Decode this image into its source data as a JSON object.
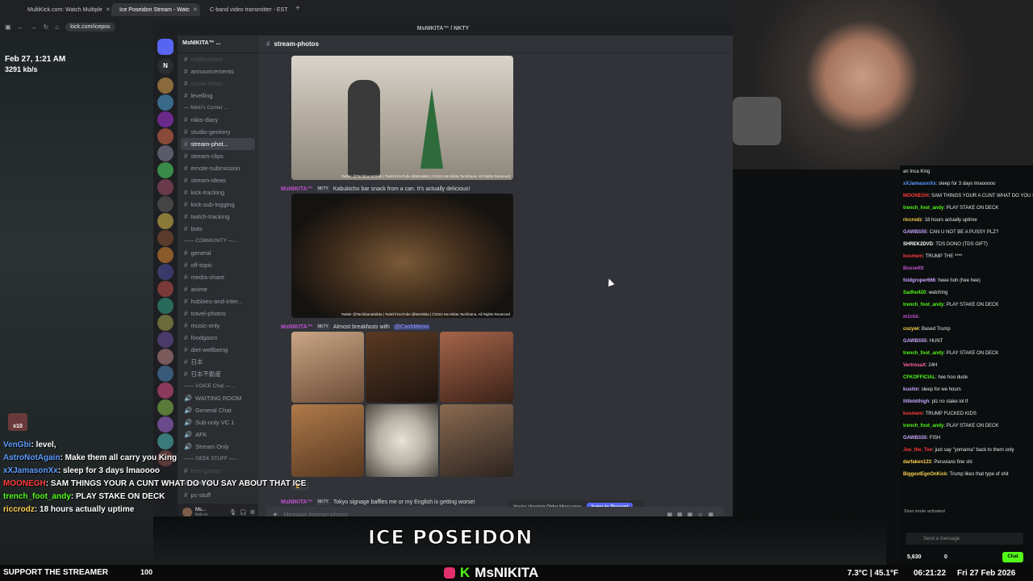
{
  "browser": {
    "tabs": [
      {
        "label": "MultiKick.com: Watch Multiple",
        "color": "#5865f2"
      },
      {
        "label": "Ice Poseidon Stream - Watc",
        "color": "#53fc18"
      },
      {
        "label": "C-band video transmitter - EST",
        "color": "#1a73e8"
      }
    ],
    "url": "kick.com/icepos"
  },
  "stream_left": {
    "timestamp": "Feb 27, 1:21 AM",
    "bitrate": "3291 kb/s"
  },
  "discord": {
    "window_title": "MsNIKITA™ / NKTY",
    "server_name": "MsNIKITA™ ...",
    "channel_header": "stream-photos",
    "channels": [
      {
        "label": "notifications",
        "type": "muted"
      },
      {
        "label": "announcements",
        "type": "normal"
      },
      {
        "label": "social-feeds",
        "type": "muted"
      },
      {
        "label": "levelling",
        "type": "normal"
      },
      {
        "label": "— Nikki's Corner ...",
        "type": "cat"
      },
      {
        "label": "nikis-diary",
        "type": "normal"
      },
      {
        "label": "studio-geekery",
        "type": "normal"
      },
      {
        "label": "stream-phot...",
        "type": "sel"
      },
      {
        "label": "stream-clips",
        "type": "normal"
      },
      {
        "label": "emote-submission",
        "type": "normal"
      },
      {
        "label": "stream-ideas",
        "type": "normal"
      },
      {
        "label": "kick-tracking",
        "type": "normal"
      },
      {
        "label": "kick-sub-logging",
        "type": "normal"
      },
      {
        "label": "twitch-tracking",
        "type": "normal"
      },
      {
        "label": "bots",
        "type": "normal"
      },
      {
        "label": "—— COMMUNITY —...",
        "type": "cat"
      },
      {
        "label": "general",
        "type": "normal"
      },
      {
        "label": "off-topic",
        "type": "normal"
      },
      {
        "label": "media-share",
        "type": "normal"
      },
      {
        "label": "anime",
        "type": "normal"
      },
      {
        "label": "hobbies-and-inter...",
        "type": "normal"
      },
      {
        "label": "travel-photos",
        "type": "normal"
      },
      {
        "label": "music-only",
        "type": "normal"
      },
      {
        "label": "foodgasm",
        "type": "normal"
      },
      {
        "label": "diet-wellbeing",
        "type": "normal"
      },
      {
        "label": "日本",
        "type": "normal"
      },
      {
        "label": "日本不動産",
        "type": "normal"
      },
      {
        "label": "—— VOICE Chat —...",
        "type": "cat"
      },
      {
        "label": "WAITING ROOM",
        "type": "voice"
      },
      {
        "label": "General Chat",
        "type": "voice"
      },
      {
        "label": "Sub-only VC 1",
        "type": "voice"
      },
      {
        "label": "AFK",
        "type": "voice"
      },
      {
        "label": "Stream Only",
        "type": "voice"
      },
      {
        "label": "—— GEEK STUFF —...",
        "type": "cat"
      },
      {
        "label": "free-games",
        "type": "muted"
      },
      {
        "label": "gaming",
        "type": "normal"
      },
      {
        "label": "pc-stuff",
        "type": "normal"
      }
    ],
    "user_panel": {
      "name": "Ms...",
      "sub": "kick.co"
    },
    "messages": [
      {
        "author": "MsNIKITA™",
        "tag": "NKTY",
        "text": "Kabukicho bar snack from a can. It's actually delicious!"
      },
      {
        "author": "MsNIKITA™",
        "tag": "NKTY",
        "text": "Almost breakfasts with",
        "mention": "@CashMeow"
      },
      {
        "author": "MsNIKITA™",
        "tag": "NKTY",
        "text": "Tokyo signage baffles me or my English is getting worse!"
      }
    ],
    "photo_caption": "Twitter @TachibanaNikita | Twitch/YouTube @MsNikita | ©2022 Ms Nikita Tachibana. All Rights Reserved",
    "reaction": {
      "emoji": "👌",
      "count": "1"
    },
    "older_notice": "You're Viewing Older Messages",
    "jump_label": "Jump to Present",
    "composer_placeholder": "Message #stream-photos"
  },
  "kick_chat": {
    "messages": [
      {
        "user": "",
        "text": "an Inca King",
        "color": "#ffffff"
      },
      {
        "user": "xXJamasonXx",
        "text": "sleep for 3 days lmaooooo",
        "color": "#5b9bff"
      },
      {
        "user": "MOONEGH",
        "text": "SAM THINGS YOUR A CUNT WHAT DO YOU SAY ABOUT THAT ICE",
        "color": "#ff3b3b"
      },
      {
        "user": "trench_foot_andy",
        "text": "PLAY STAKE ON DECK",
        "color": "#53fc18"
      },
      {
        "user": "riccrodz",
        "text": "18 hours actually uptime",
        "color": "#ffd34f"
      },
      {
        "user": "GAWBS55",
        "text": "CAN U NOT BE A PUSSY PLZ?",
        "color": "#c9a6ff"
      },
      {
        "user": "SHREK2DVD",
        "text": "TDS DONO (TDS GIFT)",
        "color": "#ffffff"
      },
      {
        "user": "kosmem",
        "text": "TRUMP THE ****",
        "color": "#ff3b3b"
      },
      {
        "user": "Bosse69",
        "text": "",
        "color": "#c252d4"
      },
      {
        "user": "foidgroper666",
        "text": "heee hoh (hee hee)",
        "color": "#c9a6ff"
      },
      {
        "user": "Sadhu420",
        "text": "watching",
        "color": "#53fc18"
      },
      {
        "user": "trench_foot_andy",
        "text": "PLAY STAKE ON DECK",
        "color": "#53fc18"
      },
      {
        "user": "m1ckk",
        "text": "",
        "color": "#c252d4"
      },
      {
        "user": "cozywi",
        "text": "Based Trump",
        "color": "#ffd34f"
      },
      {
        "user": "GAWBS55",
        "text": "HUNT",
        "color": "#c9a6ff"
      },
      {
        "user": "trench_foot_andy",
        "text": "PLAY STAKE ON DECK",
        "color": "#53fc18"
      },
      {
        "user": "VertrosaX",
        "text": "24H",
        "color": "#ff66aa"
      },
      {
        "user": "CFKOFFICIAL",
        "text": "hee hoo dude",
        "color": "#53fc18"
      },
      {
        "user": "kushin",
        "text": "sleep for we hours",
        "color": "#c9a6ff"
      },
      {
        "user": "littlebithigh",
        "text": "plz no stake lol tf",
        "color": "#c9a6ff"
      },
      {
        "user": "kosmem",
        "text": "TRUMP FUCKED KIDS",
        "color": "#ff3b3b"
      },
      {
        "user": "trench_foot_andy",
        "text": "PLAY STAKE ON DECK",
        "color": "#53fc18"
      },
      {
        "user": "GAWBS55",
        "text": "FISH",
        "color": "#c9a6ff"
      },
      {
        "user": "Joe_the_Toe",
        "text": "just say \"yomama\" back to them only",
        "color": "#ff3b3b"
      },
      {
        "user": "darfaken123",
        "text": "Peruvians fine shi",
        "color": "#ffd34f"
      },
      {
        "user": "BiggestEgoOnKick",
        "text": "Trump likes that type of shit",
        "color": "#ffd34f"
      }
    ],
    "slow_mode": "Slow mode activated",
    "send_placeholder": "Send a message",
    "viewers": "5,630",
    "followers": "0",
    "chat_button": "Chat"
  },
  "overlay_chat": [
    {
      "user": "VenGbi",
      "text": "level,",
      "color": "#5b9bff"
    },
    {
      "user": "AstroNotAgain",
      "text": "Make them all carry you King",
      "color": "#5b9bff"
    },
    {
      "user": "xXJamasonXx",
      "text": "sleep for 3 days lmaoooo",
      "color": "#5b9bff"
    },
    {
      "user": "MOONEGH",
      "text": "SAM THINGS YOUR A CUNT WHAT DO YOU SAY ABOUT THAT ICE",
      "color": "#ff3b3b"
    },
    {
      "user": "trench_foot_andy",
      "text": "PLAY STAKE ON DECK",
      "color": "#53fc18"
    },
    {
      "user": "riccrodz",
      "text": "18 hours actually uptime",
      "color": "#ffd34f"
    }
  ],
  "overlay_badge": "x10",
  "bottom": {
    "logo": "ICE POSEIDON",
    "support": "SUPPORT THE STREAMER",
    "support_count": "100",
    "streamer": "MsNIKITA",
    "weather": "7.3°C | 45.1°F",
    "clock": "06:21:22",
    "date": "Fri 27 Feb 2026"
  }
}
